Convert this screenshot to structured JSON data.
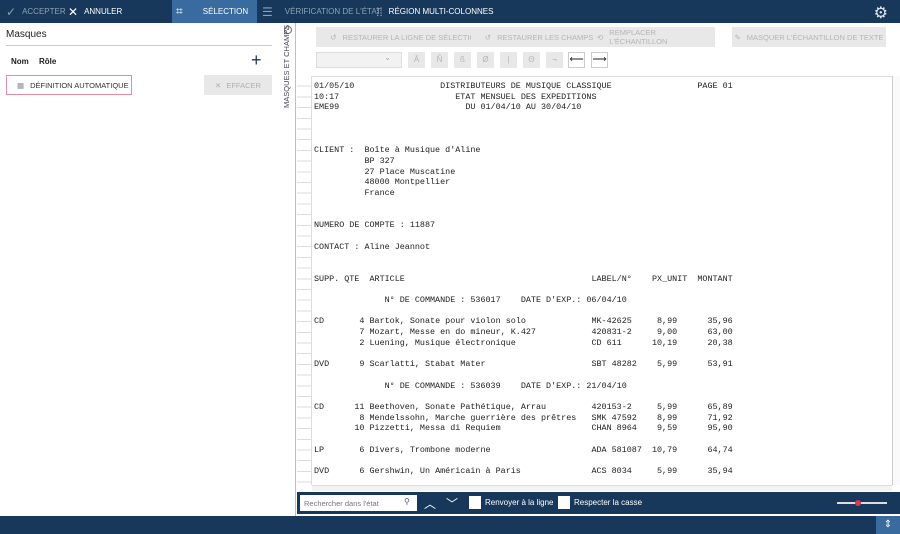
{
  "topbar": {
    "accept": "ACCEPTER",
    "cancel": "ANNULER",
    "tabs": [
      {
        "label": "SÉLECTION",
        "selected": true
      },
      {
        "label": "VÉRIFICATION DE L'ÉTAT",
        "selected": false
      },
      {
        "label": "RÉGION MULTI-COLONNES",
        "selected": false
      }
    ]
  },
  "left_panel": {
    "title": "Masques",
    "col_name": "Nom",
    "col_role": "Rôle",
    "auto_def": "DÉFINITION AUTOMATIQUE",
    "clear": "EFFACER"
  },
  "side_tab": "MASQUES ET CHAMPS",
  "toolbar": {
    "restore_line": "RESTAURER LA LIGNE DE SÉLECTION",
    "restore_fields": "RESTAURER LES CHAMPS",
    "replace_sample": "REMPLACER L'ÉCHANTILLON",
    "mask_sample": "MASQUER L'ÉCHANTILLON DE TEXTE",
    "chars": [
      "Ā",
      "Ñ",
      "ß",
      "Ø",
      "|",
      "Θ",
      "¬"
    ]
  },
  "report": {
    "header": {
      "date": "01/05/10",
      "time": "10:17",
      "code": "EME99",
      "company": "DISTRIBUTEURS DE MUSIQUE CLASSIQUE",
      "title": "ETAT MENSUEL DES EXPEDITIONS",
      "period": "DU 01/04/10 AU 30/04/10",
      "page": "PAGE 01"
    },
    "client_label": "CLIENT :",
    "client": [
      "Boîte à Musique d'Aline",
      "BP 327",
      "27 Place Muscatine",
      "48000 Montpellier",
      "France"
    ],
    "account": "NUMERO DE COMPTE : 11887",
    "contact": "CONTACT : Aline Jeannot",
    "columns": {
      "supp": "SUPP.",
      "qty": "QTE",
      "article": "ARTICLE",
      "label": "LABEL/N°",
      "unit": "PX_UNIT",
      "amount": "MONTANT"
    },
    "orders": [
      {
        "heading": "N° DE COMMANDE : 536017",
        "date": "DATE D'EXP.: 06/04/10",
        "items": [
          {
            "supp": "CD",
            "qty": "4",
            "article": "Bartok, Sonate pour violon solo",
            "label": "MK-42625",
            "unit": "8,99",
            "amount": "35,96"
          },
          {
            "supp": "",
            "qty": "7",
            "article": "Mozart, Messe en do mineur, K.427",
            "label": "420831-2",
            "unit": "9,00",
            "amount": "63,00"
          },
          {
            "supp": "",
            "qty": "2",
            "article": "Luening, Musique électronique",
            "label": "CD 611",
            "unit": "10,19",
            "amount": "20,38"
          },
          {
            "gap": true,
            "supp": "DVD",
            "qty": "9",
            "article": "Scarlatti, Stabat Mater",
            "label": "SBT 48282",
            "unit": "5,99",
            "amount": "53,91"
          }
        ]
      },
      {
        "heading": "N° DE COMMANDE : 536039",
        "date": "DATE D'EXP.: 21/04/10",
        "items": [
          {
            "supp": "CD",
            "qty": "11",
            "article": "Beethoven, Sonate Pathétique, Arrau",
            "label": "420153-2",
            "unit": "5,99",
            "amount": "65,89"
          },
          {
            "supp": "",
            "qty": "8",
            "article": "Mendelssohn, Marche guerrière des prêtres",
            "label": "SMK 47592",
            "unit": "8,99",
            "amount": "71,92"
          },
          {
            "supp": "",
            "qty": "10",
            "article": "Pizzetti, Messa di Requiem",
            "label": "CHAN 8964",
            "unit": "9,59",
            "amount": "95,90"
          },
          {
            "gap": true,
            "supp": "LP",
            "qty": "6",
            "article": "Divers, Trombone moderne",
            "label": "ADA 581087",
            "unit": "10,79",
            "amount": "64,74"
          },
          {
            "gap": true,
            "supp": "DVD",
            "qty": "6",
            "article": "Gershwin, Un Américain à Paris",
            "label": "ACS 8034",
            "unit": "5,99",
            "amount": "35,94"
          }
        ]
      }
    ]
  },
  "search": {
    "placeholder": "Rechercher dans l'état",
    "wrap": "Renvoyer à la ligne",
    "case": "Respecter la casse",
    "zoom_level": 0.35
  },
  "colors": {
    "navy": "#17385a",
    "selected_tab": "#3a6b9e",
    "accent_pink": "#e33553"
  }
}
